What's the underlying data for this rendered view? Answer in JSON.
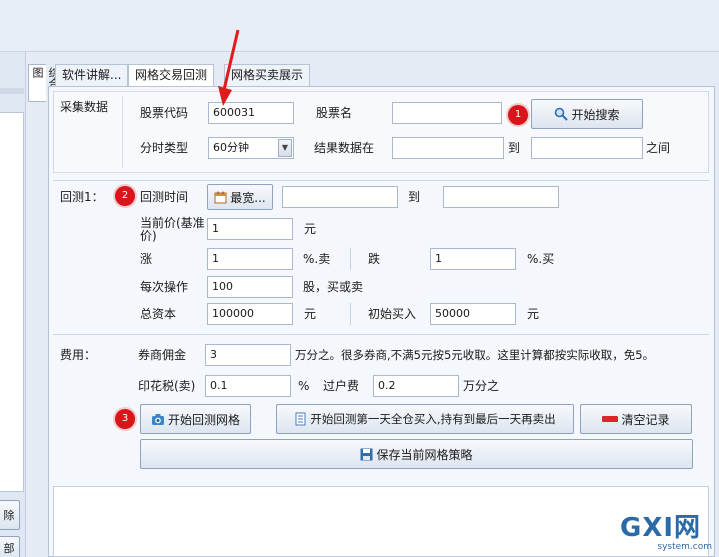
{
  "left_panel": {
    "vertical_tab": "综合图",
    "btn_delete": "除",
    "btn_all": "部"
  },
  "tabs": [
    "软件讲解...",
    "网格交易回测",
    "网格买卖展示"
  ],
  "collect": {
    "title": "采集数据",
    "stock_code_label": "股票代码",
    "stock_code_value": "600031",
    "stock_name_label": "股票名",
    "stock_name_value": "",
    "search_button": "开始搜索",
    "period_label": "分时类型",
    "period_value": "60分钟",
    "result_label": "结果数据在",
    "result_from": "",
    "to_label": "到",
    "result_to": "",
    "between_label": "之间"
  },
  "backtest": {
    "title": "回测1：",
    "time_label": "回测时间",
    "widest_button": "最宽...",
    "time_from": "",
    "to_label": "到",
    "time_to": "",
    "price_label": "当前价(基准价)",
    "price_value": "1",
    "price_unit": "元",
    "rise_label": "涨",
    "rise_value": "1",
    "rise_unit": "%.卖",
    "fall_label": "跌",
    "fall_value": "1",
    "fall_unit": "%.买",
    "op_label": "每次操作",
    "op_value": "100",
    "op_unit": "股，买或卖",
    "capital_label": "总资本",
    "capital_value": "100000",
    "capital_unit": "元",
    "initial_label": "初始买入",
    "initial_value": "50000",
    "initial_unit": "元"
  },
  "fees": {
    "title": "费用：",
    "commission_label": "券商佣金",
    "commission_value": "3",
    "commission_note": "万分之。很多券商,不满5元按5元收取。这里计算都按实际收取，免5。",
    "stamp_label": "印花税(卖)",
    "stamp_value": "0.1",
    "stamp_unit": "%",
    "transfer_label": "过户费",
    "transfer_value": "0.2",
    "transfer_unit": "万分之"
  },
  "actions": {
    "start_grid": "开始回测网格",
    "start_hold": "开始回测第一天全仓买入,持有到最后一天再卖出",
    "clear": "清空记录",
    "save": "保存当前网格策略"
  },
  "badges": [
    "1",
    "2",
    "3"
  ],
  "watermark": {
    "main": "GXI网",
    "sub": "system.com"
  },
  "colors": {
    "badge": "#d9141a",
    "arrow": "#e01b1b",
    "accent": "#2d6fb7"
  }
}
